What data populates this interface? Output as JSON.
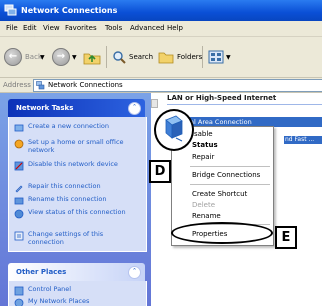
{
  "window": {
    "title": "Network Connections"
  },
  "menubar": [
    "File",
    "Edit",
    "View",
    "Favorites",
    "Tools",
    "Advanced",
    "Help"
  ],
  "toolbar": {
    "back_label": "Back",
    "search_label": "Search",
    "folders_label": "Folders"
  },
  "address": {
    "label": "Address",
    "value": "Network Connections"
  },
  "network_tasks": {
    "title": "Network Tasks",
    "items": [
      "Create a new connection",
      "Set up a home or small office network",
      "Disable this network device",
      "Repair this connection",
      "Rename this connection",
      "View status of this connection",
      "Change settings of this connection"
    ]
  },
  "other_places": {
    "title": "Other Places",
    "items": [
      "Control Panel",
      "My Network Places"
    ]
  },
  "content": {
    "group_title": "LAN or High-Speed Internet",
    "selected_item": "Local Area Connection",
    "item_detail": "nd Fast ..."
  },
  "context_menu": {
    "items": [
      "isable",
      "Status",
      "Repair",
      "Bridge Connections",
      "Create Shortcut",
      "Delete",
      "Rename",
      "Properties"
    ]
  },
  "callouts": {
    "d": "D",
    "e": "E"
  },
  "colors": {
    "title_blue": "#0a4fd6",
    "task_pane": "#6375d6",
    "selection": "#316ac5"
  }
}
